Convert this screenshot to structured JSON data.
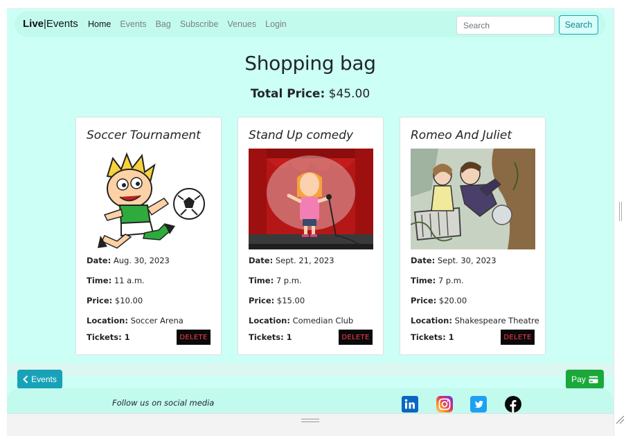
{
  "navbar": {
    "brand_bold": "Live",
    "brand_rest": "Events",
    "links": [
      "Home",
      "Events",
      "Bag",
      "Subscribe",
      "Venues",
      "Login"
    ],
    "search_placeholder": "Search",
    "search_button": "Search"
  },
  "page": {
    "title": "Shopping bag",
    "total_label": "Total Price:",
    "total_value": "$45.00"
  },
  "cards": [
    {
      "title": "Soccer Tournament",
      "date_label": "Date:",
      "date": "Aug. 30, 2023",
      "time_label": "Time:",
      "time": "11 a.m.",
      "price_label": "Price:",
      "price": "$10.00",
      "location_label": "Location:",
      "location": "Soccer Arena",
      "tickets_label": "Tickets: 1",
      "delete": "DELETE"
    },
    {
      "title": "Stand Up comedy",
      "date_label": "Date:",
      "date": "Sept. 21, 2023",
      "time_label": "Time:",
      "time": "7 p.m.",
      "price_label": "Price:",
      "price": "$15.00",
      "location_label": "Location:",
      "location": "Comedian Club",
      "tickets_label": "Tickets: 1",
      "delete": "DELETE"
    },
    {
      "title": "Romeo And Juliet",
      "date_label": "Date:",
      "date": "Sept. 30, 2023",
      "time_label": "Time:",
      "time": "7 p.m.",
      "price_label": "Price:",
      "price": "$20.00",
      "location_label": "Location:",
      "location": "Shakespeare Theatre",
      "tickets_label": "Tickets: 1",
      "delete": "DELETE"
    }
  ],
  "actions": {
    "events_button": "Events",
    "pay_button": "Pay"
  },
  "footer": {
    "follow_text": "Follow us on social media",
    "icons": [
      "linkedin-icon",
      "instagram-icon",
      "twitter-icon",
      "facebook-icon"
    ]
  },
  "colors": {
    "page_bg": "#ccfff5",
    "navbar_bg": "#c2fbee",
    "info": "#17a2b8",
    "success": "#1aa83a",
    "delete_bg": "#0a0a0a",
    "delete_text": "#ff3b4a"
  }
}
